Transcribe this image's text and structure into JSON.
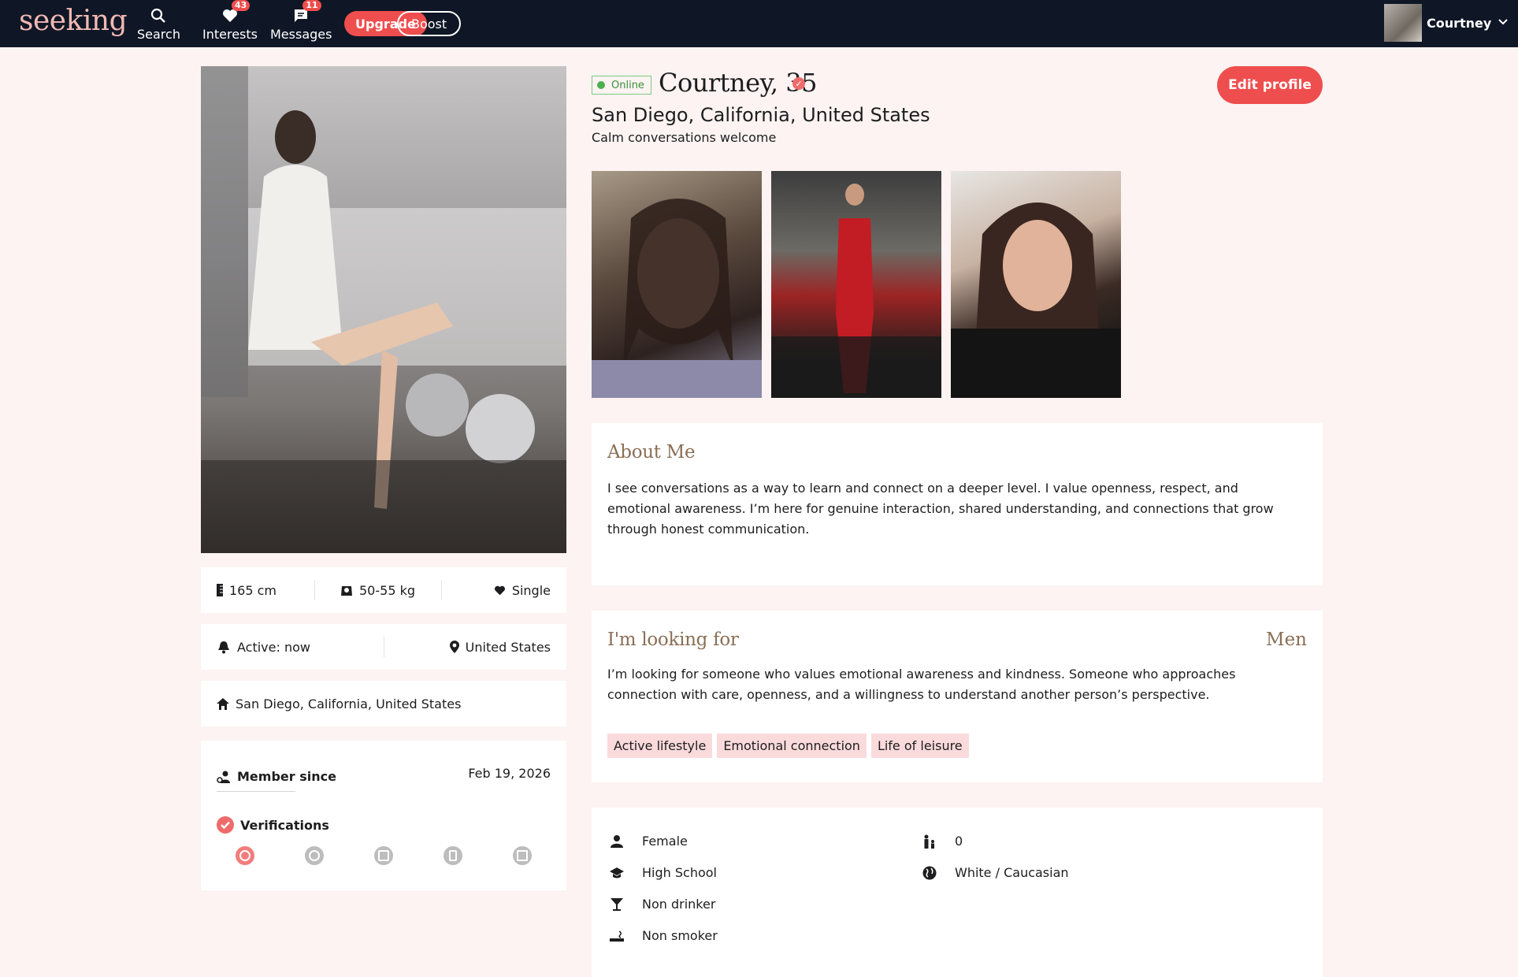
{
  "nav": {
    "logo": "seeking",
    "items": [
      {
        "label": "Search",
        "icon": "search-icon",
        "badge": ""
      },
      {
        "label": "Interests",
        "icon": "heart-icon",
        "badge": "43"
      },
      {
        "label": "Messages",
        "icon": "message-icon",
        "badge": "11"
      }
    ],
    "upgrade_label": "Upgrade",
    "boost_label": "Boost",
    "user_name": "Courtney"
  },
  "profile": {
    "status": "Online",
    "name_age": "Courtney, 35",
    "location": "San Diego, California, United States",
    "tagline": "Calm conversations welcome",
    "edit_label": "Edit profile"
  },
  "stats": {
    "height": "165 cm",
    "weight": "50-55 kg",
    "relationship": "Single",
    "active": "Active: now",
    "country": "United States",
    "home": "San Diego, California, United States"
  },
  "membership": {
    "member_since_label": "Member since",
    "member_since_date": "Feb 19, 2026",
    "verifications_label": "Verifications",
    "verification_icons": [
      "photo-verified-icon",
      "profile-icon",
      "id-card-icon",
      "facebook-icon",
      "linkedin-icon"
    ]
  },
  "about": {
    "title": "About Me",
    "text": "I see conversations as a way to learn and connect on a deeper level. I value openness, respect, and emotional awareness. I’m here for genuine interaction, shared understanding, and connections that grow through honest communication."
  },
  "looking": {
    "title": "I'm looking for",
    "target": "Men",
    "text": "I’m looking for someone who values emotional awareness and kindness. Someone who approaches connection with care, openness, and a willingness to understand another person’s perspective.",
    "tags": [
      "Active lifestyle",
      "Emotional connection",
      "Life of leisure"
    ]
  },
  "details": {
    "gender": "Female",
    "education": "High School",
    "drinking": "Non drinker",
    "smoking": "Non smoker",
    "children": "0",
    "ethnicity": "White / Caucasian"
  },
  "colors": {
    "nav_bg": "#0f1726",
    "accent": "#ef4e4e",
    "page_bg": "#fcf3f2",
    "section_title": "#8a6f56",
    "tag_bg": "#fadadb"
  }
}
